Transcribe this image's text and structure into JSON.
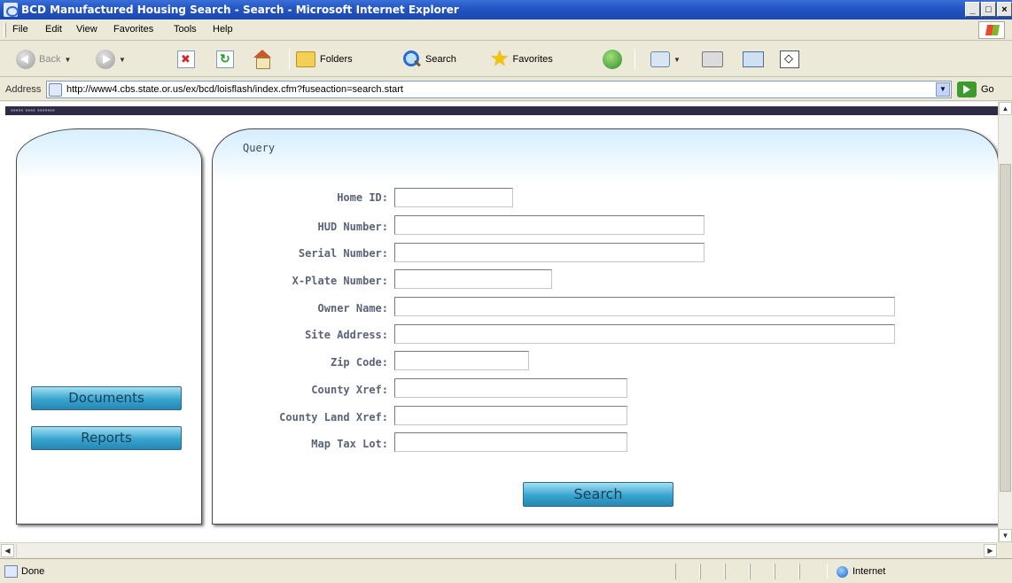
{
  "window": {
    "title": "BCD Manufactured Housing Search - Search - Microsoft Internet Explorer",
    "controls": [
      "_",
      "□",
      "×"
    ]
  },
  "menu": [
    "File",
    "Edit",
    "View",
    "Favorites",
    "Tools",
    "Help"
  ],
  "toolbar": {
    "back": "Back",
    "folders": "Folders",
    "search": "Search",
    "favorites": "Favorites"
  },
  "address": {
    "label": "Address",
    "url": "http://www4.cbs.state.or.us/ex/bcd/loisflash/index.cfm?fuseaction=search.start",
    "go": "Go"
  },
  "page": {
    "query_title": "Query",
    "nav": [
      "Documents",
      "Reports"
    ],
    "fields": [
      {
        "label": "Home ID:",
        "value": ""
      },
      {
        "label": "HUD Number:",
        "value": ""
      },
      {
        "label": "Serial Number:",
        "value": ""
      },
      {
        "label": "X-Plate Number:",
        "value": ""
      },
      {
        "label": "Owner Name:",
        "value": ""
      },
      {
        "label": "Site Address:",
        "value": ""
      },
      {
        "label": "Zip Code:",
        "value": ""
      },
      {
        "label": "County Xref:",
        "value": ""
      },
      {
        "label": "County Land Xref:",
        "value": ""
      },
      {
        "label": "Map Tax Lot:",
        "value": ""
      }
    ],
    "search_button": "Search"
  },
  "status": {
    "text": "Done",
    "zone": "Internet"
  },
  "colors": {
    "titlebar": "#2456c4",
    "button_accent": "#36a5ce",
    "panel_gradient_top": "#d4edff"
  },
  "icons": [
    "back-icon",
    "forward-icon",
    "stop-icon",
    "refresh-icon",
    "home-icon",
    "folders-icon",
    "search-icon",
    "favorites-star-icon",
    "media-icon",
    "mail-icon",
    "print-icon",
    "edit-icon",
    "messenger-icon",
    "page-icon",
    "go-arrow-icon",
    "internet-zone-icon"
  ]
}
